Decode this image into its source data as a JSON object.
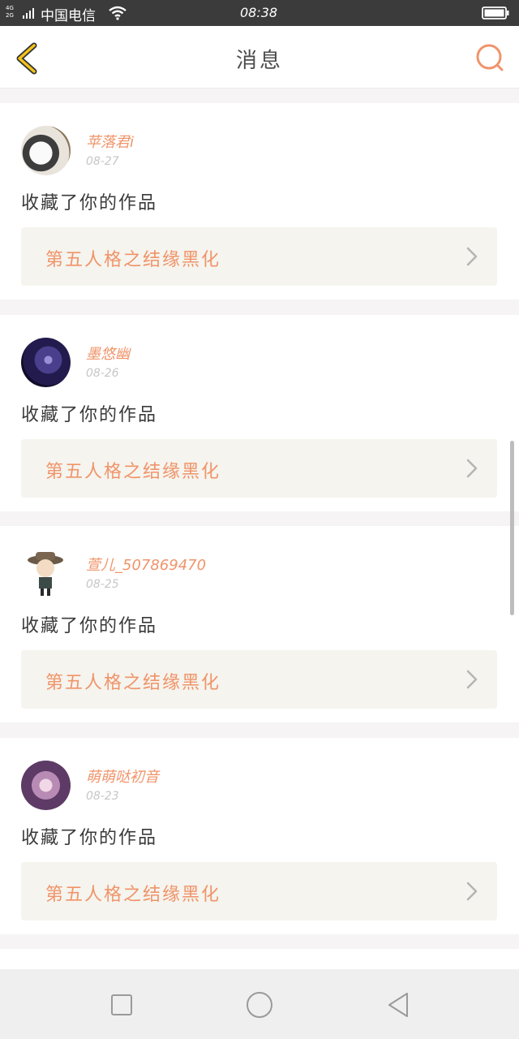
{
  "status_bar": {
    "network_top": "4G",
    "network_bottom": "2G",
    "carrier": "中国电信",
    "time": "08:38"
  },
  "header": {
    "title": "消息",
    "back_icon": "chevron-left-icon",
    "search_icon": "search-icon"
  },
  "messages": [
    {
      "username": "苹落君i",
      "date": "08-27",
      "action": "收藏了你的作品",
      "work_title": "第五人格之结缘黑化",
      "avatar": "cat-avatar"
    },
    {
      "username": "墨悠幽",
      "date": "08-26",
      "action": "收藏了你的作品",
      "work_title": "第五人格之结缘黑化",
      "avatar": "dark-anime-avatar"
    },
    {
      "username": "萱儿_507869470",
      "date": "08-25",
      "action": "收藏了你的作品",
      "work_title": "第五人格之结缘黑化",
      "avatar": "chibi-character-avatar"
    },
    {
      "username": "萌萌哒初音",
      "date": "08-23",
      "action": "收藏了你的作品",
      "work_title": "第五人格之结缘黑化",
      "avatar": "anime-girl-avatar"
    }
  ],
  "colors": {
    "accent": "#f0946a",
    "back_icon": "#f2c21b",
    "card_bg": "#ffffff",
    "work_bg": "#f5f4ee",
    "page_bg": "#f6f4f4"
  },
  "nav_bar": {
    "icons": [
      "recent-apps-icon",
      "home-icon",
      "back-triangle-icon"
    ]
  }
}
